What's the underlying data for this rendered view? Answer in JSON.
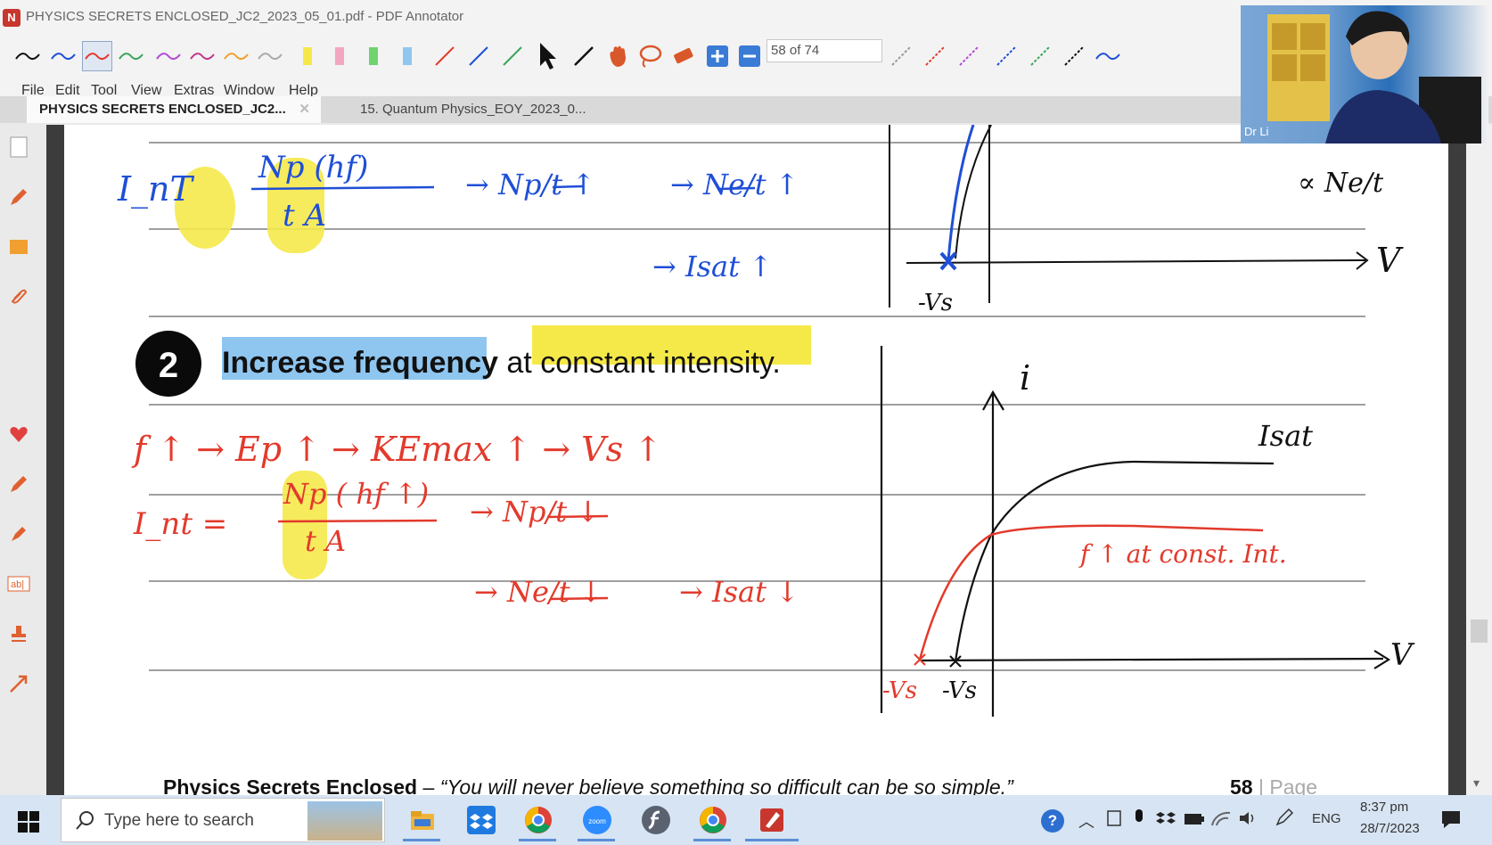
{
  "window": {
    "title": "PHYSICS SECRETS ENCLOSED_JC2_2023_05_01.pdf - PDF Annotator",
    "icon_letter": "N"
  },
  "toolbar": {
    "page_field": "58 of 74",
    "colors": {
      "black": "#111111",
      "blue": "#1f4fd6",
      "red": "#e23a2c",
      "purple": "#b44bd6",
      "orange": "#f0a030",
      "gray": "#888888"
    }
  },
  "menu": [
    "File",
    "Edit",
    "Tool",
    "View",
    "Extras",
    "Window",
    "Help"
  ],
  "tabs": [
    {
      "label": "PHYSICS SECRETS ENCLOSED_JC2...",
      "active": true
    },
    {
      "label": "15. Quantum Physics_EOY_2023_0...",
      "active": false
    }
  ],
  "webcam": {
    "label": "Dr Li"
  },
  "document": {
    "section_number": "2",
    "heading_part1": "Increase frequency",
    "heading_part2": " at ",
    "heading_part3": "constant intensity.",
    "footer_title": "Physics Secrets Enclosed",
    "footer_dash": " – ",
    "footer_quote": "“You will never believe something so difficult can be so simple.”",
    "page_number": "58",
    "page_word": "| Page",
    "annotations_top": {
      "int_label": "I_nT",
      "fraction_num": "Np (hf)",
      "fraction_den": "t A",
      "step1": "Np/t ↑",
      "step2": "Ne/t ↑",
      "step3": "Isat ↑",
      "graph_label_v": "V",
      "graph_label_vs": "-Vs",
      "right_note": "∝ Ne/t"
    },
    "annotations_bottom": {
      "chain": "f ↑ → Ep ↑ → KEmax ↑ → Vs ↑",
      "int_label": "I_nt",
      "fraction_num": "Np ( hf ↑)",
      "fraction_den": "t A",
      "step1": "Np/t ↓",
      "step2": "Ne/t ↓",
      "step3": "Isat ↓",
      "axis_i": "i",
      "axis_v": "V",
      "isat_label": "Isat",
      "curve_note": "f ↑ at const. Int.",
      "vs_red": "-Vs",
      "vs_black": "-Vs"
    }
  },
  "taskbar": {
    "search_placeholder": "Type here to search",
    "lang": "ENG",
    "time": "8:37 pm",
    "date": "28/7/2023"
  }
}
